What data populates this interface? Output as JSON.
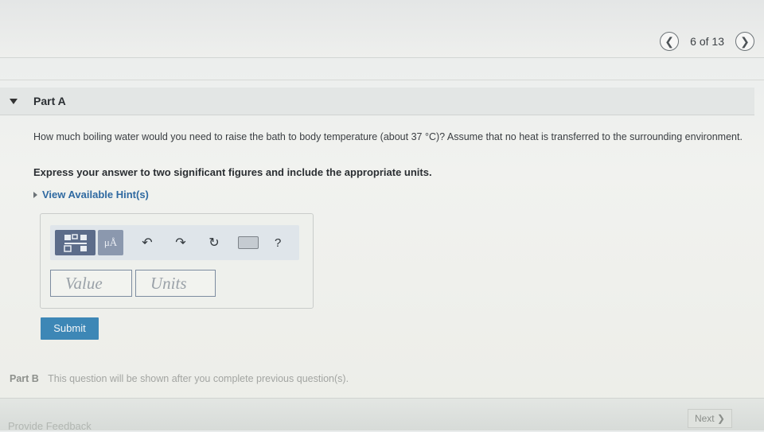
{
  "pager": {
    "count": "6 of 13",
    "prev_icon": "chevron-left-icon",
    "next_icon": "chevron-right-icon"
  },
  "part_a": {
    "label": "Part A",
    "question": "How much boiling water would you need to raise the bath to body temperature (about 37 °C)? Assume that no heat is transferred to the surrounding environment.",
    "instruction": "Express your answer to two significant figures and include the appropriate units.",
    "hint_link": "View Available Hint(s)",
    "toolbar": {
      "mu_label": "μÅ",
      "help_label": "?"
    },
    "value_placeholder": "Value",
    "units_placeholder": "Units",
    "submit_label": "Submit"
  },
  "part_b": {
    "label": "Part B",
    "text": "This question will be shown after you complete previous question(s)."
  },
  "footer": {
    "next_label": "Next ❯",
    "feedback": "Provide Feedback"
  },
  "colors": {
    "accent": "#3d87b6",
    "link": "#2f6aa1",
    "toolbar_main": "#5c6c8a"
  }
}
